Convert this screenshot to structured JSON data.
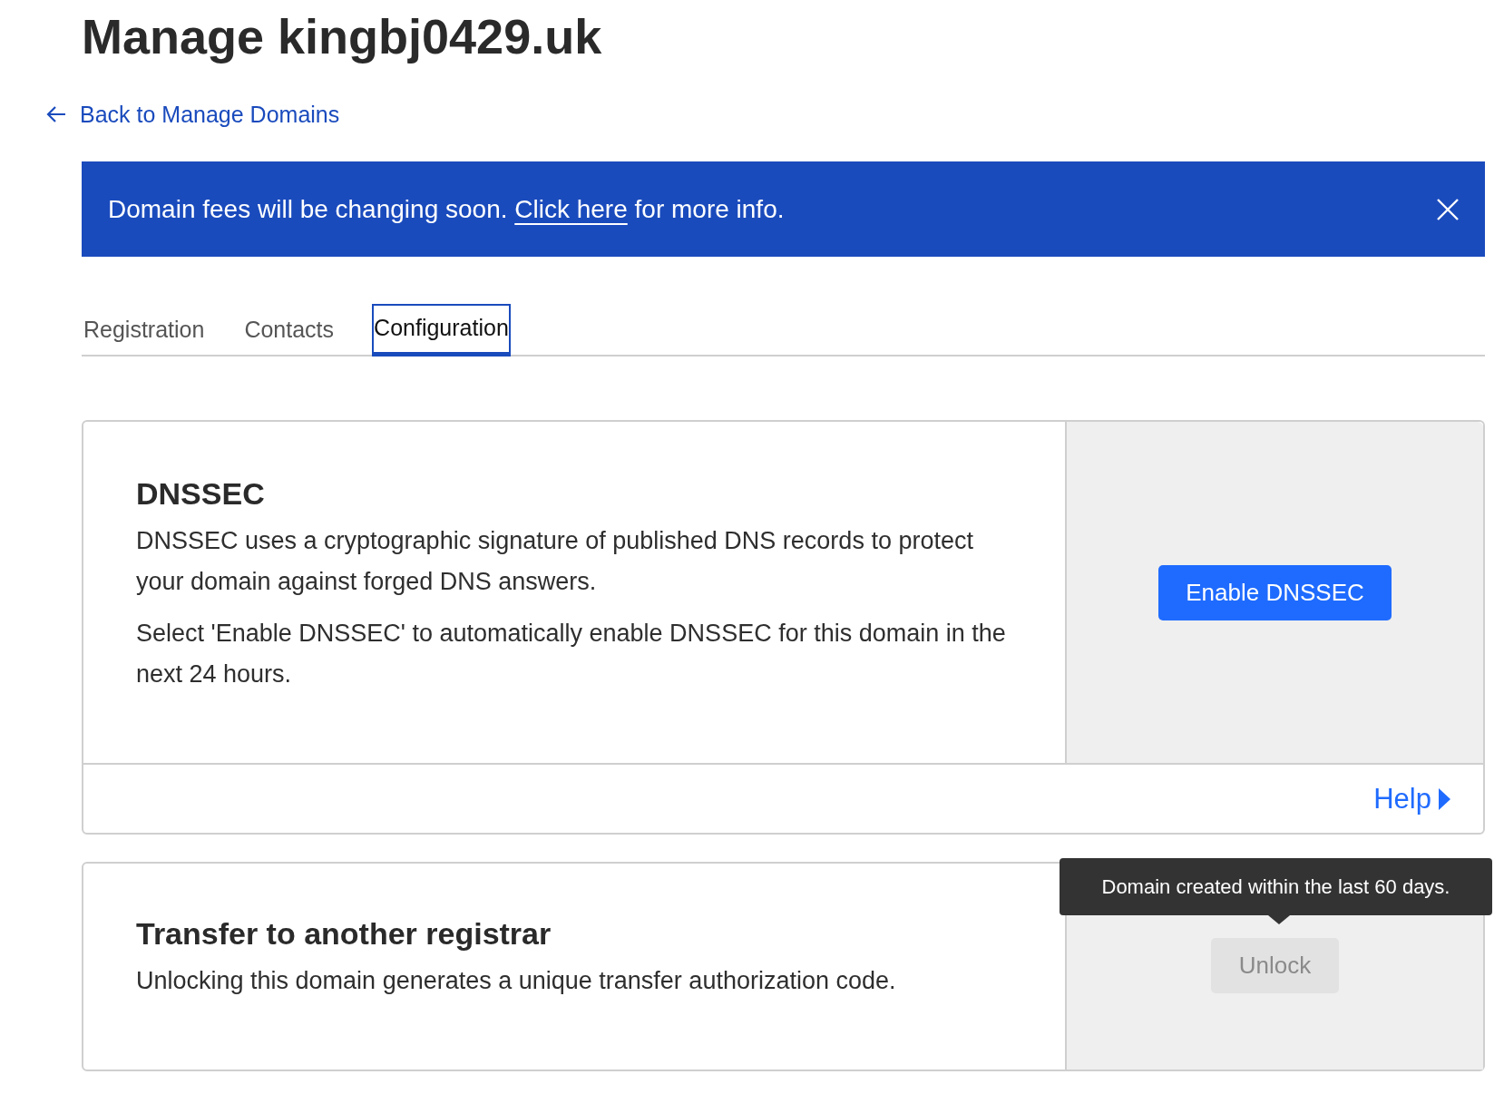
{
  "title": "Manage kingbj0429.uk",
  "back_link": {
    "label": "Back to Manage Domains"
  },
  "banner": {
    "text_before": "Domain fees will be changing soon. ",
    "link": "Click here",
    "text_after": " for more info."
  },
  "tabs": [
    {
      "label": "Registration",
      "selected": false
    },
    {
      "label": "Contacts",
      "selected": false
    },
    {
      "label": "Configuration",
      "selected": true
    }
  ],
  "cards": [
    {
      "title": "DNSSEC",
      "paragraphs": [
        "DNSSEC uses a cryptographic signature of published DNS records to protect your domain against forged DNS answers.",
        "Select 'Enable DNSSEC' to automatically enable DNSSEC for this domain in the next 24 hours."
      ],
      "button": {
        "label": "Enable DNSSEC",
        "disabled": false
      },
      "footer_link": "Help"
    },
    {
      "title": "Transfer to another registrar",
      "paragraphs": [
        "Unlocking this domain generates a unique transfer authorization code."
      ],
      "button": {
        "label": "Unlock",
        "disabled": true
      },
      "tooltip": "Domain created within the last 60 days."
    }
  ]
}
